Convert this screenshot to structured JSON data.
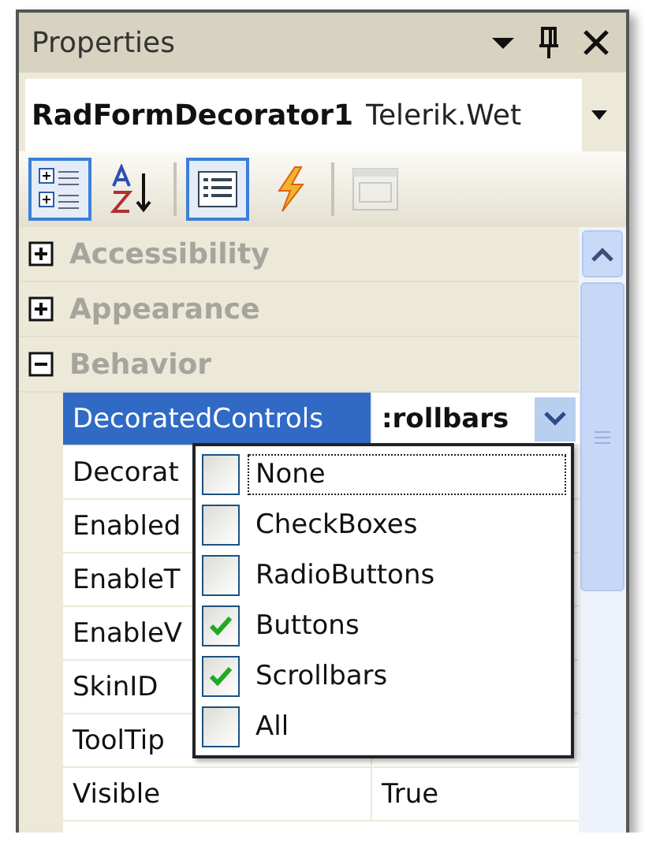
{
  "window": {
    "title": "Properties"
  },
  "object_selector": {
    "name": "RadFormDecorator1",
    "type": "Telerik.Wet"
  },
  "toolbar": [
    {
      "kind": "categorized",
      "selected": true,
      "disabled": false
    },
    {
      "kind": "alphabetical",
      "selected": false,
      "disabled": false
    },
    {
      "kind": "separator"
    },
    {
      "kind": "properties",
      "selected": true,
      "disabled": false
    },
    {
      "kind": "events",
      "selected": false,
      "disabled": false
    },
    {
      "kind": "separator"
    },
    {
      "kind": "pages",
      "selected": false,
      "disabled": true
    }
  ],
  "categories": [
    {
      "label": "Accessibility",
      "expanded": false
    },
    {
      "label": "Appearance",
      "expanded": false
    },
    {
      "label": "Behavior",
      "expanded": true,
      "children": [
        {
          "name": "DecoratedControls",
          "value": ":rollbars",
          "selected": true
        },
        {
          "name": "Decorat",
          "selected": false
        },
        {
          "name": "Enabled",
          "selected": false
        },
        {
          "name": "EnableT",
          "selected": false
        },
        {
          "name": "EnableV",
          "selected": false
        },
        {
          "name": "SkinID",
          "selected": false
        },
        {
          "name": "ToolTip",
          "selected": false
        },
        {
          "name": "Visible",
          "value": "True",
          "selected": false
        }
      ]
    }
  ],
  "dropdown": {
    "options": [
      {
        "label": "None",
        "checked": false,
        "focused": true
      },
      {
        "label": "CheckBoxes",
        "checked": false,
        "focused": false
      },
      {
        "label": "RadioButtons",
        "checked": false,
        "focused": false
      },
      {
        "label": "Buttons",
        "checked": true,
        "focused": false
      },
      {
        "label": "Scrollbars",
        "checked": true,
        "focused": false
      },
      {
        "label": "All",
        "checked": false,
        "focused": false
      }
    ]
  }
}
